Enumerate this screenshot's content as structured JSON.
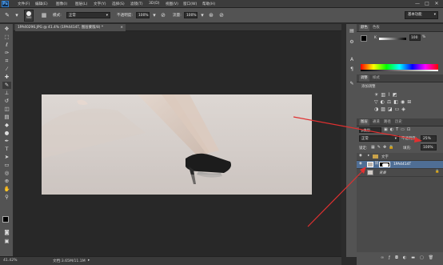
{
  "app": {
    "logo": "Ps",
    "menu": [
      "文件(F)",
      "编辑(E)",
      "图像(I)",
      "图层(L)",
      "文字(Y)",
      "选择(S)",
      "滤镜(T)",
      "3D(D)",
      "视图(V)",
      "窗口(W)",
      "帮助(H)"
    ],
    "window_controls": [
      "—",
      "□",
      "✕"
    ]
  },
  "options": {
    "brush_size": "500",
    "mode_label": "模式:",
    "mode_value": "正常",
    "opacity_label": "不透明度:",
    "opacity_value": "100%",
    "flow_label": "流量:",
    "flow_value": "100%",
    "workspace": "基本功能"
  },
  "document": {
    "tab_title": "1PA40296.JPG @ 41.4% (1PA4414T, 图层蒙版/8) *",
    "tab_close": "×"
  },
  "status": {
    "zoom": "41.42%",
    "doc_size": "文档:3.65M/11.1M"
  },
  "color_panel": {
    "tabs": [
      "颜色",
      "色板"
    ],
    "k_label": "K",
    "k_value": "100",
    "percent": "%"
  },
  "adjust_panel": {
    "tabs": [
      "调整",
      "样式"
    ],
    "title": "添加调整"
  },
  "layers_panel": {
    "tabs": [
      "图层",
      "通道",
      "路径",
      "历史"
    ],
    "kind_label": "ρ类型",
    "blend_mode": "正常",
    "opacity_label": "不透明度:",
    "opacity_value": "25%",
    "lock_label": "锁定:",
    "fill_label": "填充:",
    "fill_value": "100%",
    "layers": [
      {
        "name": "文字",
        "type": "group",
        "visible": true
      },
      {
        "name": "1PA4414T",
        "type": "layer",
        "visible": true,
        "selected": true
      },
      {
        "name": "背景",
        "type": "background",
        "visible": false
      }
    ]
  },
  "annotation_color": "#e03030"
}
